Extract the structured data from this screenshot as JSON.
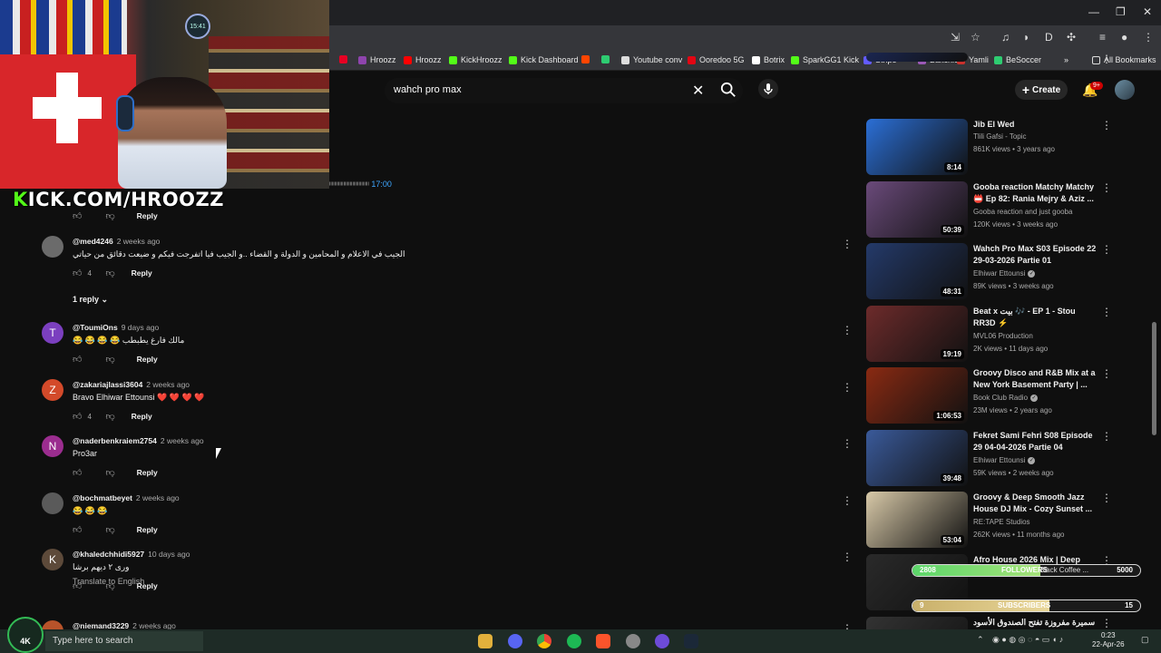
{
  "window": {
    "minimize": "—",
    "restore": "❐",
    "close": "✕"
  },
  "bookmarks": [
    {
      "label": "",
      "color": "#e60023"
    },
    {
      "label": "Hroozz",
      "color": "#8e44ad"
    },
    {
      "label": "Hroozz",
      "color": "#ff0000"
    },
    {
      "label": "KickHroozz",
      "color": "#53fc18"
    },
    {
      "label": "Kick Dashboard",
      "color": "#53fc18"
    },
    {
      "label": "",
      "color": "#ff4500"
    },
    {
      "label": "",
      "color": "#2ecc71"
    },
    {
      "label": "Youtube conv",
      "color": "#dddddd"
    },
    {
      "label": "Ooredoo 5G",
      "color": "#e30613"
    },
    {
      "label": "Botrix",
      "color": "#ffffff"
    },
    {
      "label": "SparkGG1 Kick",
      "color": "#53fc18"
    },
    {
      "label": "Stripe",
      "color": "#635bff"
    },
    {
      "label": "Bakchich",
      "color": "#9b59b6"
    },
    {
      "label": "Yamli",
      "color": "#c9302c"
    },
    {
      "label": "BeSoccer",
      "color": "#2ecc71"
    }
  ],
  "all_bookmarks": "All Bookmarks",
  "search": {
    "query": "wahch pro max",
    "clear": "✕"
  },
  "header": {
    "create": "Create",
    "notif_badge": "9+"
  },
  "stream": {
    "kick_url_k": "K",
    "kick_url_rest": "ICK.COM/HROOZZ",
    "clock_text": "15:41"
  },
  "timestamp_line": {
    "text": "ᵎᵎᵎᵎᵎᵎᵎᵎᵎᵎᵎᵎᵎᵎᵎᵎᵎᵎᵎᵎᵎᵎᵎᵎᵎᵎᵎᵎᵎᵎᵎ",
    "time": "17:00"
  },
  "comments": [
    {
      "author": "",
      "ago": "",
      "text": "",
      "likes": "",
      "reply": "Reply",
      "avatar_letter": "",
      "avatar_color": "#000"
    },
    {
      "author": "@med4246",
      "ago": "2 weeks ago",
      "text": "الجيب في الاعلام و المحامين و الدولة و القضاء ..و الجيب فيا اتفرجت فيكم و ضيعت دقائق من حياتي",
      "likes": "4",
      "reply": "Reply",
      "avatar_letter": "",
      "avatar_color": "#6b6b6b"
    },
    {
      "author": "@ToumiOns",
      "ago": "9 days ago",
      "text": "😂 😂 😂 😂 مالك فارغ يطبطب",
      "likes": "",
      "reply": "Reply",
      "avatar_letter": "T",
      "avatar_color": "#7b3fbf"
    },
    {
      "author": "@zakariajlassi3604",
      "ago": "2 weeks ago",
      "text": "Bravo Elhiwar Ettounsi ❤️ ❤️ ❤️ ❤️",
      "likes": "4",
      "reply": "Reply",
      "avatar_letter": "Z",
      "avatar_color": "#d34a2a"
    },
    {
      "author": "@naderbenkraiem2754",
      "ago": "2 weeks ago",
      "text": "Pro3ar",
      "likes": "",
      "reply": "Reply",
      "avatar_letter": "N",
      "avatar_color": "#9b2d8f"
    },
    {
      "author": "@bochmatbeyet",
      "ago": "2 weeks ago",
      "text": "😂 😂 😂",
      "likes": "",
      "reply": "Reply",
      "avatar_letter": "",
      "avatar_color": "#5a5a5a"
    },
    {
      "author": "@khaledchhidi5927",
      "ago": "10 days ago",
      "text": "ورى ٢ ديهم برشا",
      "likes": "",
      "reply": "Reply",
      "avatar_letter": "K",
      "avatar_color": "#5d4a3a"
    },
    {
      "author": "@niemand3229",
      "ago": "2 weeks ago",
      "text": "",
      "likes": "",
      "reply": "",
      "avatar_letter": "",
      "avatar_color": "#b8532a"
    }
  ],
  "reply_toggle": "1 reply",
  "translate": "Translate to English",
  "sidebar": [
    {
      "title": "",
      "channel": "",
      "meta": "",
      "duration": "",
      "verified": false,
      "thumb": "#1a2650"
    },
    {
      "title": "Jib El Wed",
      "channel": "Tlili Gafsi - Topic",
      "meta": "861K views • 3 years ago",
      "duration": "8:14",
      "verified": false,
      "thumb": "#2b6fd6"
    },
    {
      "title": "Gooba reaction Matchy Matchy 📛 Ep 82: Rania Mejry & Aziz ...",
      "channel": "Gooba reaction and just gooba",
      "meta": "120K views • 3 weeks ago",
      "duration": "50:39",
      "verified": false,
      "thumb": "#6a4a7a"
    },
    {
      "title": "Wahch Pro Max S03 Episode 22 29-03-2026 Partie 01",
      "channel": "Elhiwar Ettounsi",
      "meta": "89K views • 3 weeks ago",
      "duration": "48:31",
      "verified": true,
      "thumb": "#243a6a"
    },
    {
      "title": "Beat x بيت 🎶 - EP 1 - Stou RR3D ⚡",
      "channel": "MVL06 Production",
      "meta": "2K views • 11 days ago",
      "duration": "19:19",
      "verified": false,
      "thumb": "#6d2b2b"
    },
    {
      "title": "Groovy Disco and R&B Mix at a New York Basement Party | ...",
      "channel": "Book Club Radio",
      "meta": "23M views • 2 years ago",
      "duration": "1:06:53",
      "verified": true,
      "thumb": "#8a2a12"
    },
    {
      "title": "Fekret Sami Fehri S08 Episode 29 04-04-2026 Partie 04",
      "channel": "Elhiwar Ettounsi",
      "meta": "59K views • 2 weeks ago",
      "duration": "39:48",
      "verified": true,
      "thumb": "#3a5a9a"
    },
    {
      "title": "Groovy & Deep Smooth Jazz House DJ Mix - Cozy Sunset ...",
      "channel": "RE:TAPE Studios",
      "meta": "262K views • 11 months ago",
      "duration": "53:04",
      "verified": false,
      "thumb": "#d8c9a8"
    },
    {
      "title": "Afro House 2026 Mix | Deep",
      "channel": "Afro House Loop",
      "meta": "",
      "duration": "",
      "verified": false,
      "thumb": "#2a2a2a"
    },
    {
      "title": "سميرة مفروزة تفتح الصندوق الأسود لحياتها",
      "channel": "",
      "meta": "",
      "duration": "",
      "verified": false,
      "thumb": "#333"
    }
  ],
  "overlay": {
    "followers_left": "2808",
    "followers_label": "FOLLOWERS",
    "followers_right": "5000",
    "followers_progress": 0.56,
    "subs_left": "9",
    "subs_label": "SUBSCRIBERS",
    "subs_right": "15",
    "subs_progress": 0.6,
    "overlap_text": "Black Coffee ..."
  },
  "taskbar": {
    "search_placeholder": "Type here to search",
    "time": "0:23",
    "date": "22-Apr-26",
    "logo": "4K"
  },
  "colors": {
    "bg": "#0f0f0f",
    "kick_green": "#53fc18",
    "yt_red": "#cc0000"
  }
}
